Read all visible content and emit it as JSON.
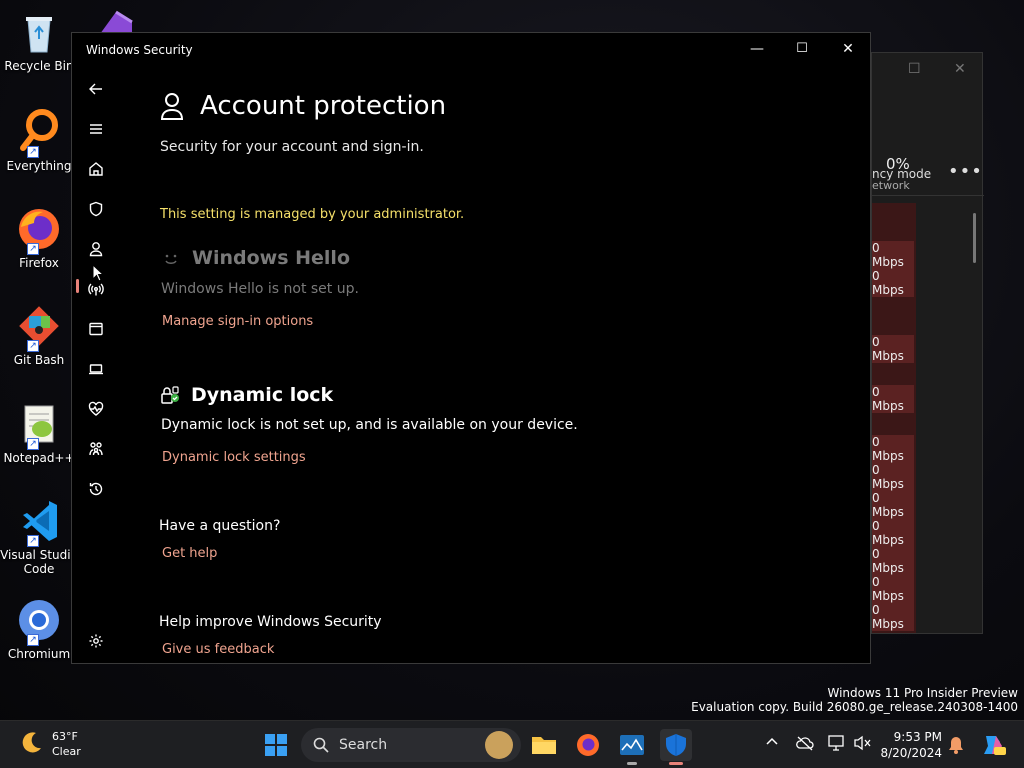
{
  "desktop": {
    "icons": [
      {
        "label": "Recycle Bin"
      },
      {
        "label": "Everything"
      },
      {
        "label": "Firefox"
      },
      {
        "label": "Git Bash"
      },
      {
        "label": "Notepad++"
      },
      {
        "label": "Visual Studio Code"
      },
      {
        "label": "Chromium"
      }
    ]
  },
  "background_window": {
    "mode_label": "ncy mode",
    "percent": "0%",
    "column_label": "etwork",
    "rows": [
      "0 Mbps",
      "0 Mbps",
      "0 Mbps",
      "0 Mbps",
      "0 Mbps",
      "0 Mbps",
      "0 Mbps",
      "0 Mbps",
      "0 Mbps",
      "0 Mbps",
      "0 Mbps"
    ]
  },
  "window": {
    "title": "Windows Security",
    "minimize": "—",
    "maximize": "☐",
    "close": "✕"
  },
  "page": {
    "title": "Account protection",
    "subtitle": "Security for your account and sign-in.",
    "managed_notice": "This setting is managed by your administrator.",
    "hello": {
      "heading": "Windows Hello",
      "status": "Windows Hello is not set up.",
      "link": "Manage sign-in options"
    },
    "dynamic_lock": {
      "heading": "Dynamic lock",
      "status": "Dynamic lock is not set up, and is available on your device.",
      "link": "Dynamic lock settings"
    },
    "question": {
      "heading": "Have a question?",
      "link": "Get help"
    },
    "improve": {
      "heading": "Help improve Windows Security",
      "link": "Give us feedback"
    }
  },
  "watermark": {
    "line1": "Windows 11 Pro Insider Preview",
    "line2": "Evaluation copy. Build 26080.ge_release.240308-1400"
  },
  "taskbar": {
    "weather_temp": "63°F",
    "weather_cond": "Clear",
    "search_label": "Search",
    "time": "9:53 PM",
    "date": "8/20/2024"
  },
  "colors": {
    "accent_link": "#f0a48f",
    "managed_notice": "#f5e06a",
    "active_indicator": "#e8837a"
  }
}
